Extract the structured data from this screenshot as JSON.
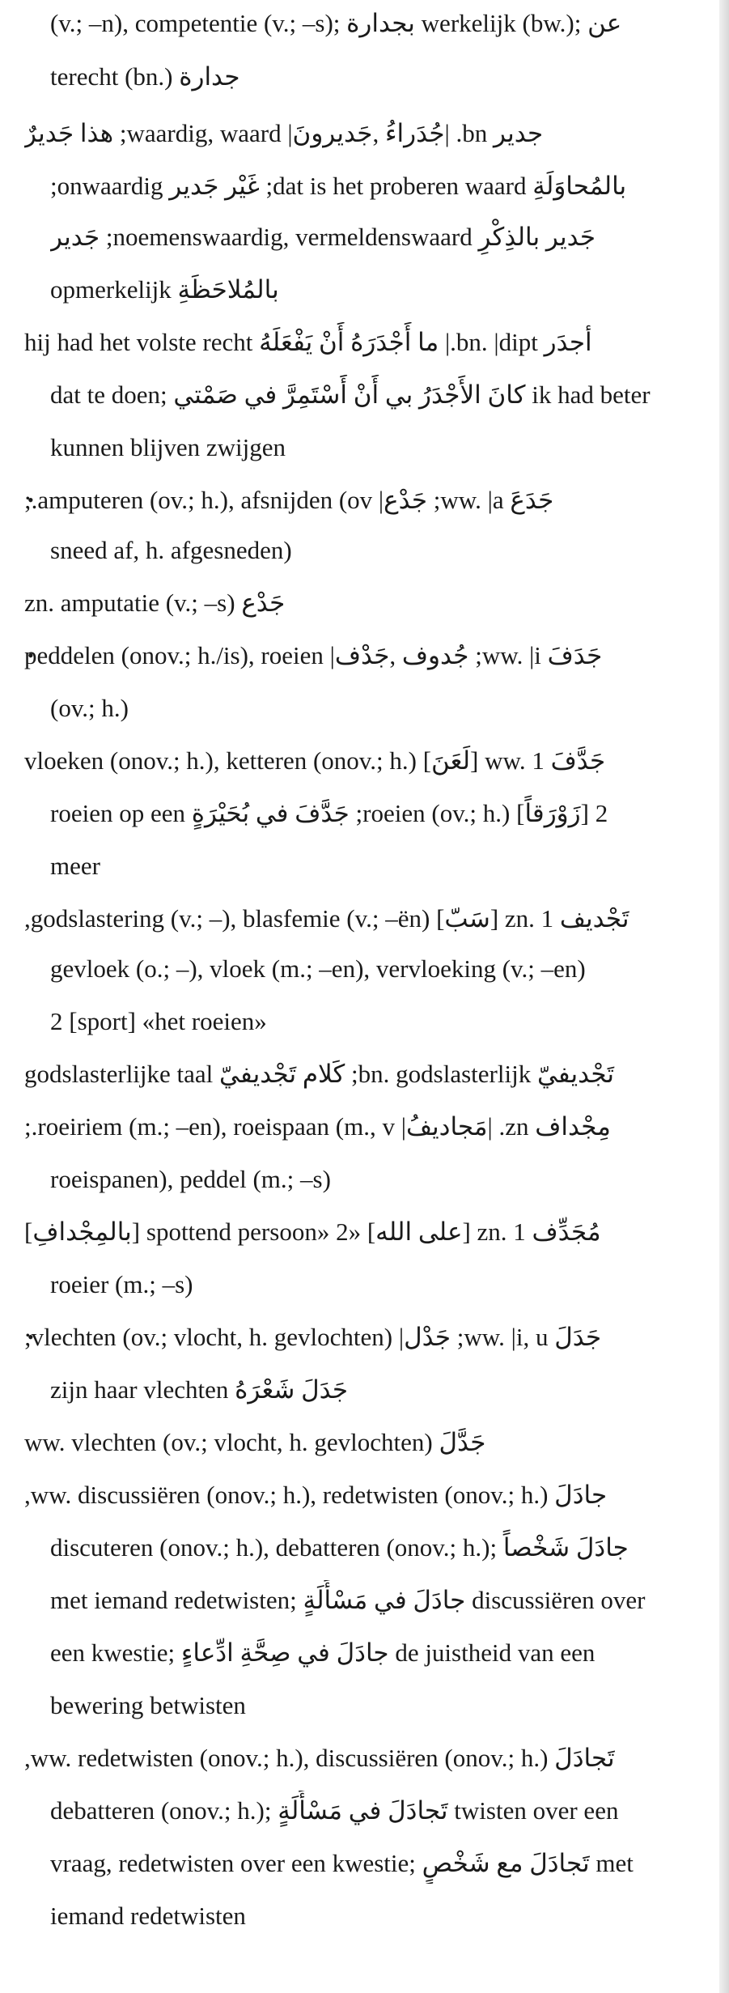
{
  "lines": [
    {
      "text": "(v.; –n), competentie (v.; –s); بجدارة werkelijk (bw.); عن",
      "kind": "cont",
      "bullet": false
    },
    {
      "text": "جدارة terecht (bn.)",
      "kind": "cont",
      "bullet": false
    },
    {
      "text": "جدير bn. |جُدَراءُ ,جَديرونَ| waardig, waard; هذا جَديرٌ",
      "kind": "head",
      "bullet": false
    },
    {
      "text": "بالمُحاوَلَةِ dat is het proberen waard; غَيْر جَدير onwaardig;",
      "kind": "cont",
      "bullet": false
    },
    {
      "text": "جَدير بالذِكْرِ noemenswaardig, vermeldenswaard; جَدير",
      "kind": "cont",
      "bullet": false
    },
    {
      "text": "بالمُلاحَظَةِ opmerkelijk",
      "kind": "cont",
      "bullet": false
    },
    {
      "text": "أجدَر bn. |dipt.| ما أَجْدَرَهُ أَنْ يَفْعَلَهُ hij had het volste recht",
      "kind": "head",
      "bullet": false
    },
    {
      "text": "dat te doen; كانَ الأَجْدَرُ بي أَنْ أَسْتَمِرَّ في صَمْتي ik had beter",
      "kind": "cont",
      "bullet": false
    },
    {
      "text": "kunnen blijven zwijgen",
      "kind": "cont",
      "bullet": false
    },
    {
      "text": "جَدَعَ ww. |a; جَدْع| amputeren (ov.; h.), afsnijden (ov.;",
      "kind": "head",
      "bullet": true
    },
    {
      "text": "sneed af, h. afgesneden)",
      "kind": "cont",
      "bullet": false
    },
    {
      "text": "جَدْع zn. amputatie (v.; –s)",
      "kind": "head",
      "bullet": false
    },
    {
      "text": "جَدَفَ ww. |i; جُدوف ,جَدْف| peddelen (onov.; h./is), roeien",
      "kind": "head",
      "bullet": true
    },
    {
      "text": "(ov.; h.)",
      "kind": "cont",
      "bullet": false
    },
    {
      "text": "جَدَّفَ ww. 1 [لَعَنَ] vloeken (onov.; h.), ketteren (onov.; h.)",
      "kind": "head",
      "bullet": false
    },
    {
      "text": "2 [زَوْرَقاً] roeien (ov.; h.); جَدَّفَ في بُحَيْرَةٍ roeien op een",
      "kind": "cont",
      "bullet": false
    },
    {
      "text": "meer",
      "kind": "cont",
      "bullet": false
    },
    {
      "text": "تَجْديف zn. 1 [سَبّ] godslastering (v.; –), blasfemie (v.; –ën),",
      "kind": "head",
      "bullet": false
    },
    {
      "text": "gevloek (o.; –), vloek (m.; –en), vervloeking (v.; –en)",
      "kind": "cont",
      "bullet": false
    },
    {
      "text": "2 [sport] «het roeien»",
      "kind": "cont",
      "bullet": false
    },
    {
      "text": "تَجْديفيّ bn. godslasterlijk; كَلام تَجْديفيّ godslasterlijke taal",
      "kind": "head",
      "bullet": false
    },
    {
      "text": "مِجْداف zn. |مَجاديفُ| roeiriem (m.; –en), roeispaan (m., v.;",
      "kind": "head",
      "bullet": false
    },
    {
      "text": "roeispanen), peddel (m.; –s)",
      "kind": "cont",
      "bullet": false
    },
    {
      "text": "مُجَدِّف zn. 1 [على الله] «spottend persoon» 2 [بالمِجْدافِ]",
      "kind": "head",
      "bullet": false
    },
    {
      "text": "roeier (m.; –s)",
      "kind": "cont",
      "bullet": false
    },
    {
      "text": "جَدَلَ ww. |i, u; جَدْل| vlechten (ov.; vlocht, h. gevlochten);",
      "kind": "head",
      "bullet": true
    },
    {
      "text": "جَدَلَ شَعْرَهُ zijn haar vlechten",
      "kind": "cont",
      "bullet": false
    },
    {
      "text": "جَدَّلَ ww. vlechten (ov.; vlocht, h. gevlochten)",
      "kind": "head",
      "bullet": false
    },
    {
      "text": "جادَلَ ww. discussiëren (onov.; h.), redetwisten (onov.; h.),",
      "kind": "head",
      "bullet": false
    },
    {
      "text": "discuteren (onov.; h.), debatteren (onov.; h.); جادَلَ شَخْصاً",
      "kind": "cont",
      "bullet": false
    },
    {
      "text": "met iemand redetwisten; جادَلَ في مَسْأَلَةٍ discussiëren over",
      "kind": "cont",
      "bullet": false
    },
    {
      "text": "een kwestie; جادَلَ في صِحَّةِ ادِّعاءٍ de juistheid van een",
      "kind": "cont",
      "bullet": false
    },
    {
      "text": "bewering betwisten",
      "kind": "cont",
      "bullet": false
    },
    {
      "text": "تَجادَلَ ww. redetwisten (onov.; h.), discussiëren (onov.; h.),",
      "kind": "head",
      "bullet": false
    },
    {
      "text": "debatteren (onov.; h.); تَجادَلَ في مَسْأَلَةٍ twisten over een",
      "kind": "cont",
      "bullet": false
    },
    {
      "text": "vraag, redetwisten over een kwestie; تَجادَلَ مع شَخْصٍ met",
      "kind": "cont",
      "bullet": false
    },
    {
      "text": "iemand redetwisten",
      "kind": "cont",
      "bullet": false
    }
  ],
  "bullet_glyph": "•"
}
